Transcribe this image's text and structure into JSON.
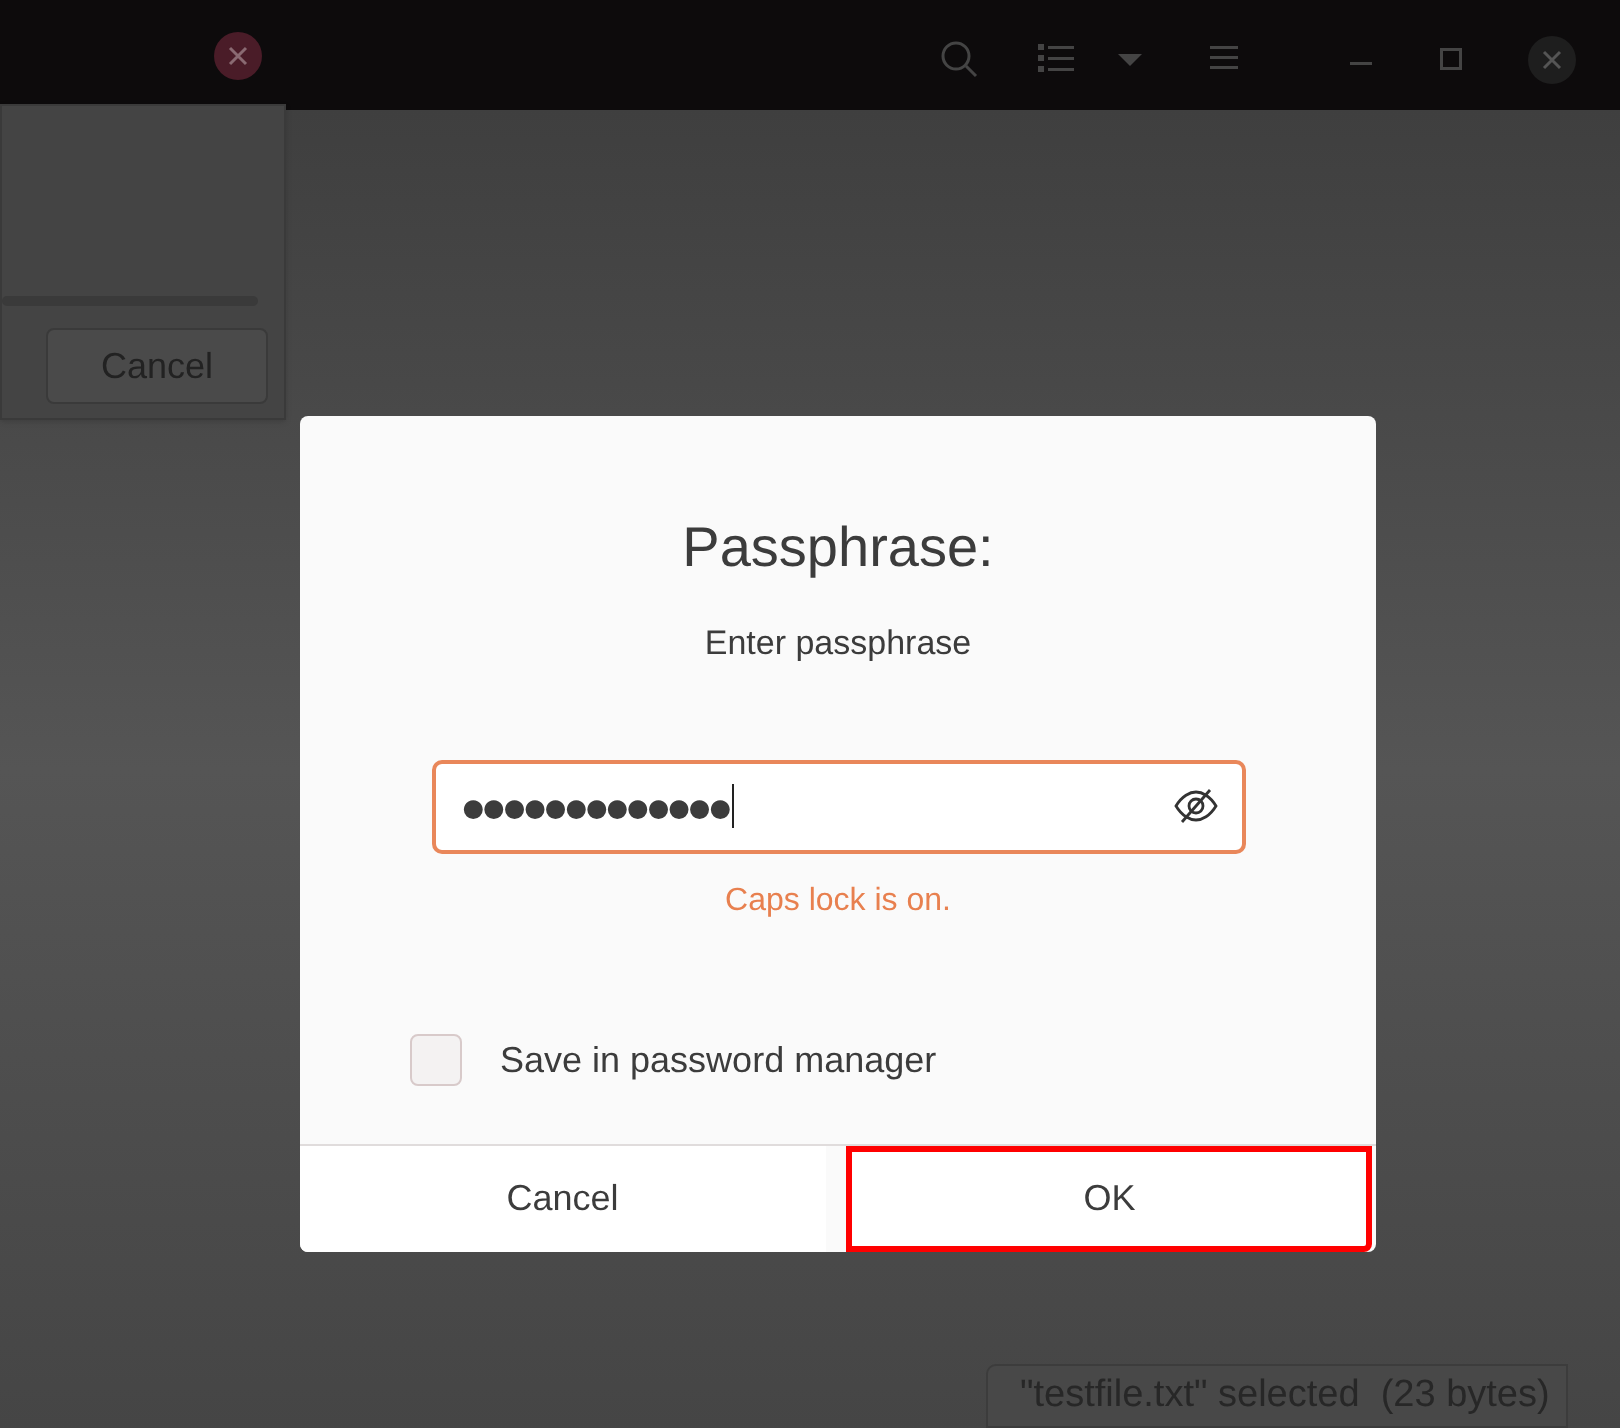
{
  "background_dialog": {
    "cancel_button": "Cancel",
    "progress": {
      "level": 0
    }
  },
  "dialog": {
    "title": "Passphrase:",
    "prompt": "Enter passphrase",
    "password_field": {
      "value": "●●●●●●●●●●●●●",
      "focused": true
    },
    "warning": "Caps lock is on.",
    "save_checkbox": {
      "label": "Save in password manager",
      "checked": false
    },
    "buttons": [
      {
        "label": "Cancel",
        "highlighted": false
      },
      {
        "label": "OK",
        "highlighted": true
      }
    ]
  },
  "status_bar": "\"testfile.txt\" selected  (23 bytes)"
}
